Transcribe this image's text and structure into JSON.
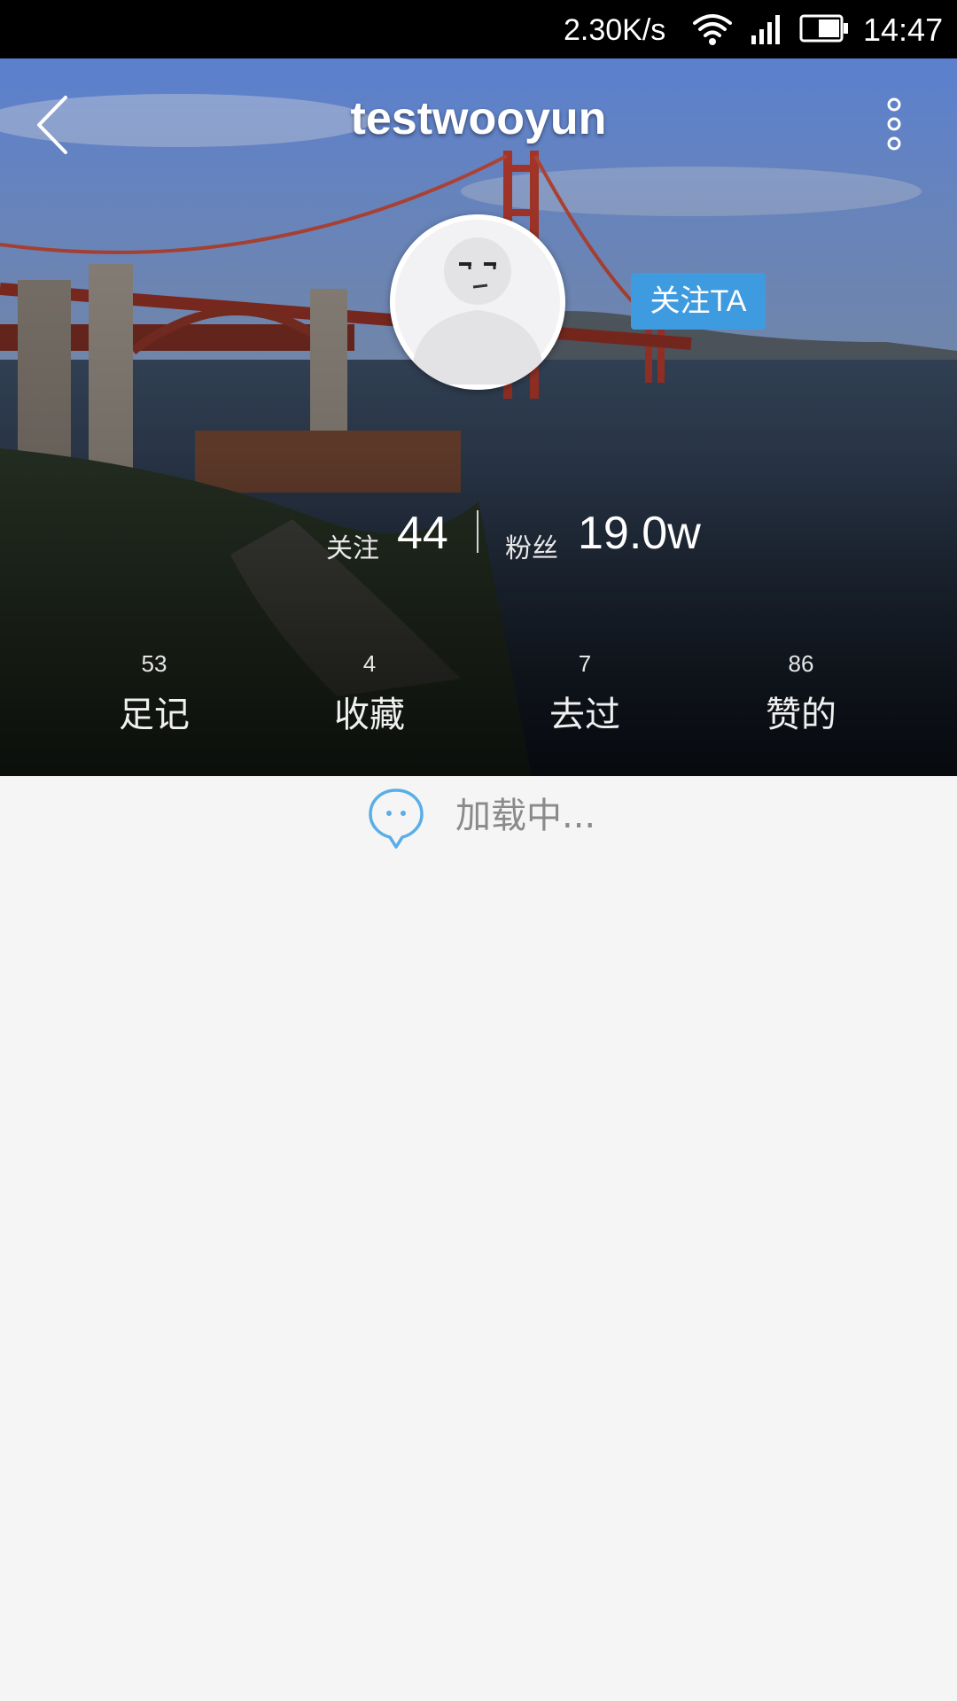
{
  "status_bar": {
    "net_speed": "2.30K/s",
    "time": "14:47",
    "icons": [
      "wifi-icon",
      "signal-icon",
      "battery-icon"
    ]
  },
  "header": {
    "title": "testwooyun",
    "back_icon": "chevron-left-icon",
    "more_icon": "vertical-dots-icon",
    "follow_button": "关注TA"
  },
  "stats": {
    "following_label": "关注",
    "following_value": "44",
    "fans_label": "粉丝",
    "fans_value": "19.0w"
  },
  "tabs": [
    {
      "count": "53",
      "label": "足记"
    },
    {
      "count": "4",
      "label": "收藏"
    },
    {
      "count": "7",
      "label": "去过"
    },
    {
      "count": "86",
      "label": "赞的"
    }
  ],
  "loading": {
    "text": "加载中...",
    "icon": "chat-bubble-icon"
  },
  "colors": {
    "accent": "#3f9be0",
    "status_bar_bg": "#000000",
    "page_bg": "#f5f5f5",
    "loading_icon": "#5aaee8"
  }
}
